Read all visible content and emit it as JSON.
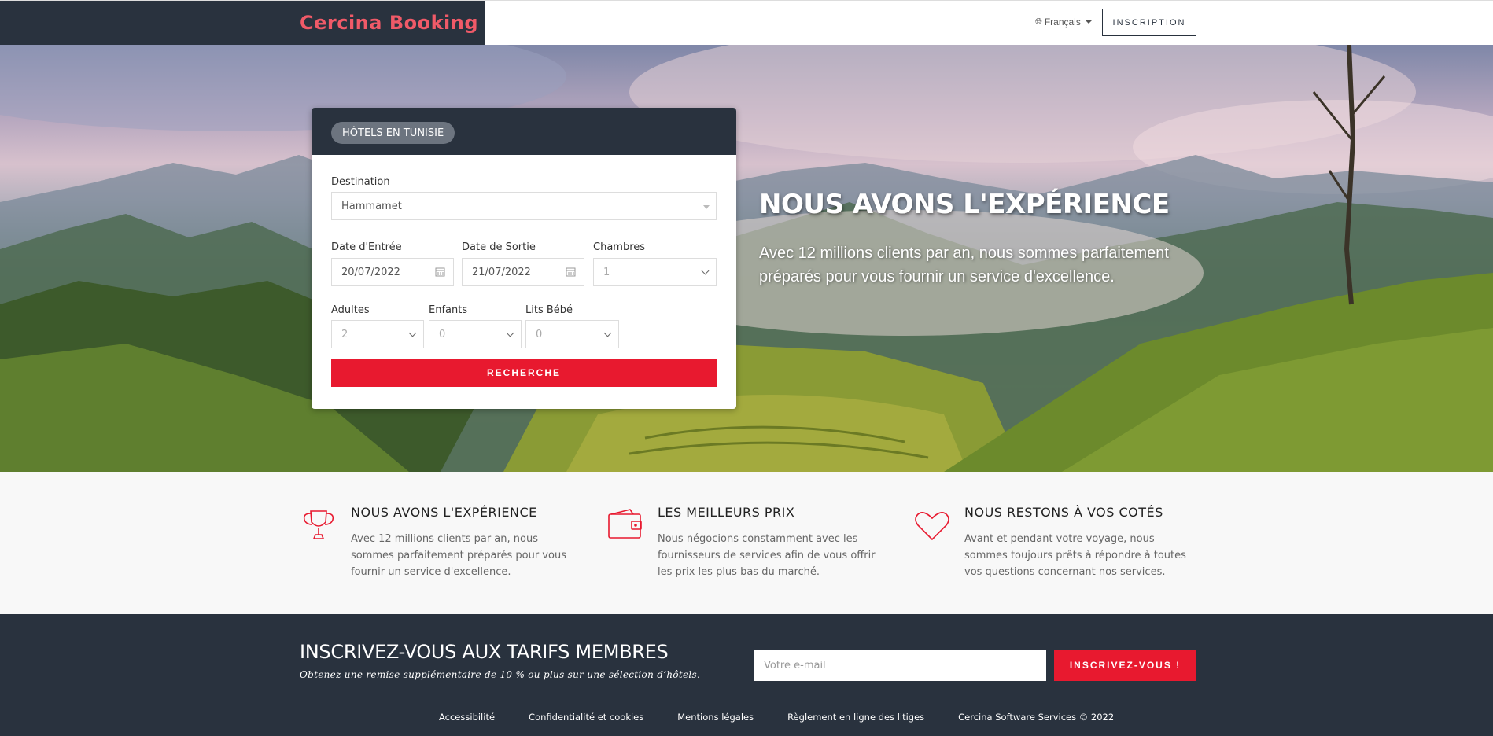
{
  "header": {
    "brand": "Cercina Booking",
    "language": "Français",
    "signup_label": "INSCRIPTION"
  },
  "search": {
    "tab_label": "HÔTELS EN TUNISIE",
    "destination_label": "Destination",
    "destination_value": "Hammamet",
    "checkin_label": "Date d'Entrée",
    "checkin_value": "20/07/2022",
    "checkout_label": "Date de Sortie",
    "checkout_value": "21/07/2022",
    "rooms_label": "Chambres",
    "rooms_value": "1",
    "adults_label": "Adultes",
    "adults_value": "2",
    "children_label": "Enfants",
    "children_value": "0",
    "cribs_label": "Lits Bébé",
    "cribs_value": "0",
    "submit_label": "RECHERCHE"
  },
  "hero": {
    "title": "NOUS AVONS L'EXPÉRIENCE",
    "subtitle": "Avec 12 millions clients par an, nous sommes parfaitement préparés pour vous fournir un service d'excellence."
  },
  "features": [
    {
      "icon": "trophy-icon",
      "title": "NOUS AVONS L'EXPÉRIENCE",
      "text": "Avec 12 millions clients par an, nous sommes parfaitement préparés pour vous fournir un service d'excellence."
    },
    {
      "icon": "wallet-icon",
      "title": "LES MEILLEURS PRIX",
      "text": "Nous négocions constamment avec les fournisseurs de services afin de vous offrir les prix les plus bas du marché."
    },
    {
      "icon": "heart-icon",
      "title": "NOUS RESTONS À VOS COTÉS",
      "text": "Avant et pendant votre voyage, nous sommes toujours prêts à répondre à toutes vos questions concernant nos services."
    }
  ],
  "newsletter": {
    "title": "INSCRIVEZ-VOUS AUX TARIFS MEMBRES",
    "subtitle": "Obtenez une remise supplémentaire de 10 % ou plus sur une sélection d’hôtels.",
    "email_placeholder": "Votre e-mail",
    "button_label": "INSCRIVEZ-VOUS !"
  },
  "footer_links": [
    "Accessibilité",
    "Confidentialité et cookies",
    "Mentions légales",
    "Règlement en ligne des litiges",
    "Cercina Software Services © 2022"
  ],
  "colors": {
    "dark": "#29323e",
    "accent": "#e8192f",
    "brand": "#f05a68"
  }
}
